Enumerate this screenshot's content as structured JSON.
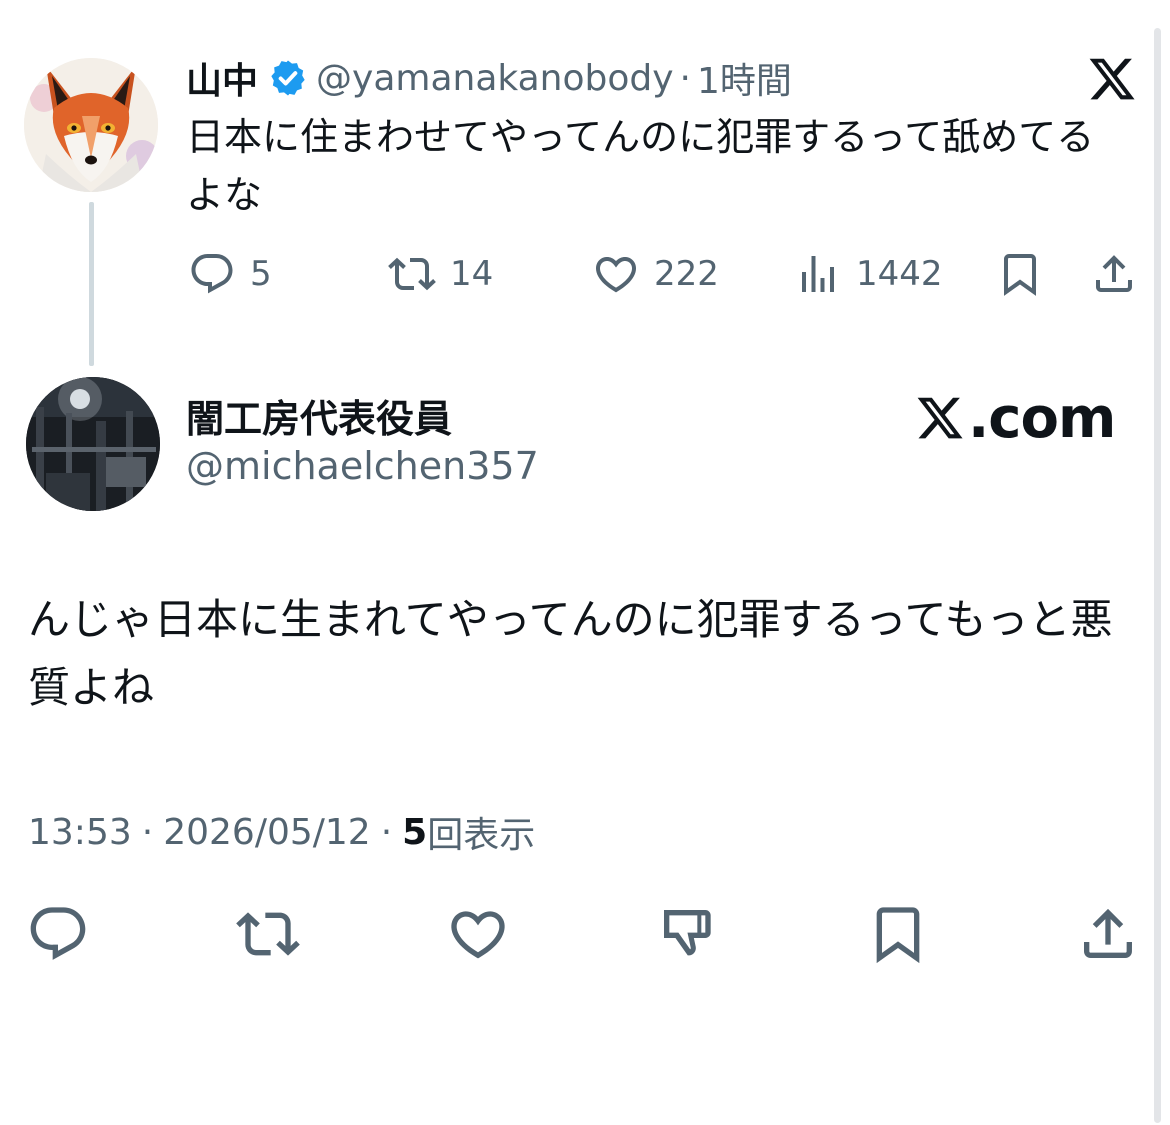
{
  "original_tweet": {
    "display_name": "山中",
    "verified": true,
    "handle": "@yamanakanobody",
    "separator": "·",
    "time_ago": "1時間",
    "text": "日本に住まわせてやってんのに犯罪するって舐めてるよな",
    "actions": {
      "replies": "5",
      "reposts": "14",
      "likes": "222",
      "views": "1442"
    },
    "source_icon": "x-logo-icon"
  },
  "reply_tweet": {
    "display_name": "闇工房代表役員",
    "handle": "@michaelchen357",
    "source_label": ".com",
    "text": "んじゃ日本に生まれてやってんのに犯罪するってもっと悪質よね",
    "time": "13:53",
    "separator": "·",
    "date": "2026/05/12",
    "view_count": "5",
    "view_label": "回表示",
    "actions": [
      "reply-icon",
      "repost-icon",
      "like-icon",
      "dislike-icon",
      "bookmark-icon",
      "share-icon"
    ]
  },
  "colors": {
    "text_primary": "#0f1419",
    "text_secondary": "#536471",
    "verified_blue": "#1d9bf0",
    "thread_line": "#cfd9de"
  }
}
